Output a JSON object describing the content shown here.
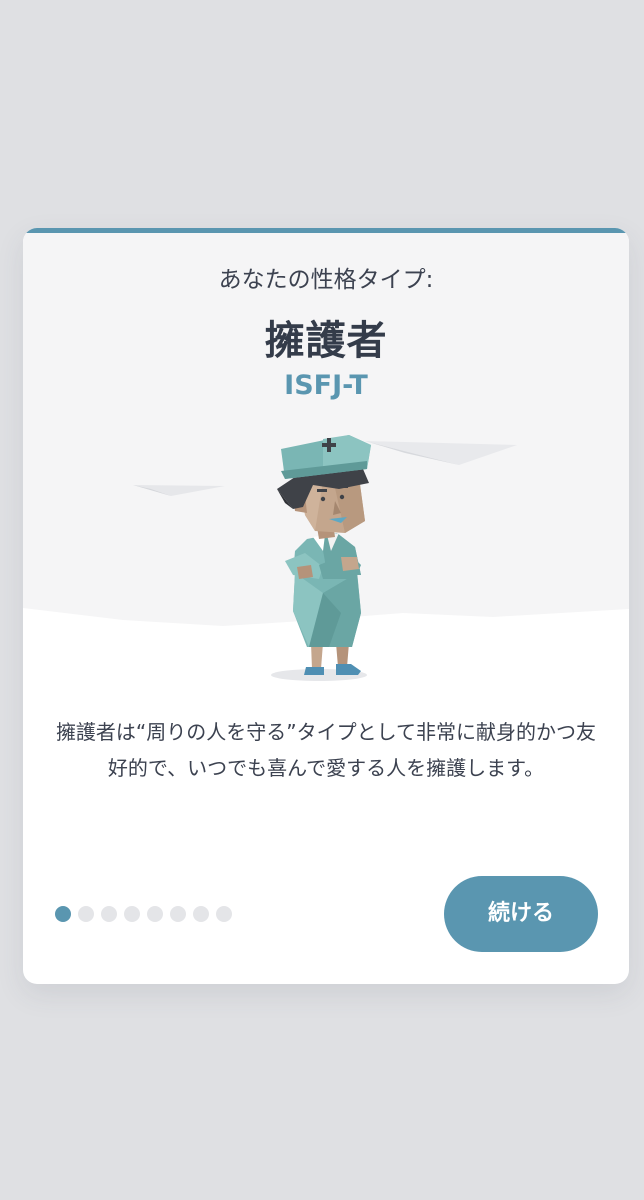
{
  "card": {
    "subtitle": "あなたの性格タイプ:",
    "type_name": "擁護者",
    "type_code": "ISFJ-T",
    "description": "擁護者は“周りの人を守る”タイプとして非常に献身的かつ友好的で、いつでも喜んで愛する人を擁護します。",
    "illustration_icon": "nurse-character-illustration"
  },
  "pager": {
    "total": 8,
    "current": 1
  },
  "actions": {
    "continue_label": "続ける"
  },
  "colors": {
    "accent": "#5a96b0",
    "background": "#dfe0e3",
    "card": "#ffffff",
    "text": "#3c4250",
    "dot_inactive": "#e4e5e8"
  }
}
